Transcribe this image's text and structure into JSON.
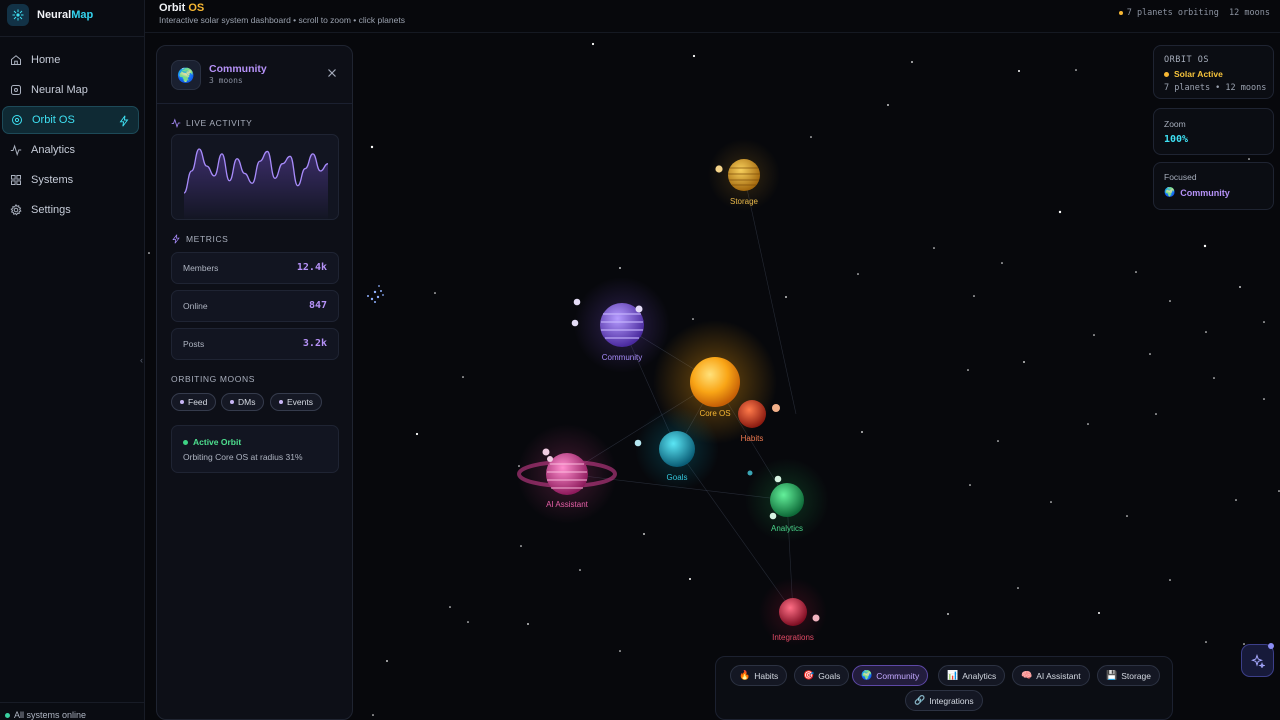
{
  "app": {
    "name_prefix": "Neural",
    "name_suffix": "Map"
  },
  "sidebar": {
    "items": [
      {
        "label": "Home",
        "icon": "home-icon"
      },
      {
        "label": "Neural Map",
        "icon": "network-icon"
      },
      {
        "label": "Orbit OS",
        "icon": "orbit-icon",
        "active": true
      },
      {
        "label": "Analytics",
        "icon": "activity-icon"
      },
      {
        "label": "Systems",
        "icon": "grid-icon"
      },
      {
        "label": "Settings",
        "icon": "gear-icon"
      }
    ],
    "status": "All systems online"
  },
  "header": {
    "title_a": "Orbit ",
    "title_b": "OS",
    "subtitle": "Interactive solar system dashboard • scroll to zoom • click planets",
    "right_status": "7 planets orbiting  12 moons"
  },
  "panel": {
    "name": "Community",
    "moons": "3 moons",
    "live_activity_label": "LIVE ACTIVITY",
    "metrics_label": "METRICS",
    "metrics": [
      {
        "label": "Members",
        "value": "12.4k"
      },
      {
        "label": "Online",
        "value": "847"
      },
      {
        "label": "Posts",
        "value": "3.2k"
      }
    ],
    "orbiting_moons_label": "ORBITING MOONS",
    "moons_list": [
      "Feed",
      "DMs",
      "Events"
    ],
    "orbit_status_title": "Active Orbit",
    "orbit_status_text": "Orbiting Core OS at radius 31%",
    "activity_series": [
      12,
      30,
      48,
      34,
      26,
      44,
      22,
      40,
      28,
      20,
      38,
      46,
      24,
      36,
      42,
      18,
      32,
      44,
      30,
      36
    ]
  },
  "cards": {
    "system_title": "ORBIT OS",
    "system_status": "Solar Active",
    "system_counts": "7 planets • 12 moons",
    "zoom_label": "Zoom",
    "zoom_value": "100%",
    "focused_label": "Focused",
    "focused_value": "Community"
  },
  "planets": [
    {
      "name": "Storage",
      "color": "#e8a322"
    },
    {
      "name": "Community",
      "color": "#8b5cf6"
    },
    {
      "name": "Core OS",
      "color": "#f59e0b"
    },
    {
      "name": "Habits",
      "color": "#ef4444"
    },
    {
      "name": "Goals",
      "color": "#06b6d4"
    },
    {
      "name": "AI Assistant",
      "color": "#ec4899"
    },
    {
      "name": "Analytics",
      "color": "#22c55e"
    },
    {
      "name": "Integrations",
      "color": "#e11d48"
    }
  ],
  "dock": [
    {
      "label": "Habits",
      "emoji": "🔥"
    },
    {
      "label": "Goals",
      "emoji": "🎯"
    },
    {
      "label": "Community",
      "emoji": "🌍",
      "active": true
    },
    {
      "label": "Analytics",
      "emoji": "📊"
    },
    {
      "label": "AI Assistant",
      "emoji": "🧠"
    },
    {
      "label": "Storage",
      "emoji": "💾"
    },
    {
      "label": "Integrations",
      "emoji": "🔗"
    }
  ]
}
